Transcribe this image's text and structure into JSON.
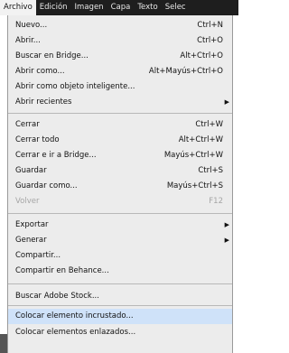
{
  "menubar": {
    "items": [
      "Archivo",
      "Edición",
      "Imagen",
      "Capa",
      "Texto",
      "Selec"
    ]
  },
  "menu": {
    "items": [
      {
        "label": "Nuevo...",
        "shortcut": "Ctrl+N"
      },
      {
        "label": "Abrir...",
        "shortcut": "Ctrl+O"
      },
      {
        "label": "Buscar en Bridge...",
        "shortcut": "Alt+Ctrl+O"
      },
      {
        "label": "Abrir como...",
        "shortcut": "Alt+Mayús+Ctrl+O"
      },
      {
        "label": "Abrir como objeto inteligente...",
        "shortcut": ""
      },
      {
        "label": "Abrir recientes",
        "shortcut": "",
        "submenu": true
      },
      {
        "label": "Cerrar",
        "shortcut": "Ctrl+W"
      },
      {
        "label": "Cerrar todo",
        "shortcut": "Alt+Ctrl+W"
      },
      {
        "label": "Cerrar e ir a Bridge...",
        "shortcut": "Mayús+Ctrl+W"
      },
      {
        "label": "Guardar",
        "shortcut": "Ctrl+S"
      },
      {
        "label": "Guardar como...",
        "shortcut": "Mayús+Ctrl+S"
      },
      {
        "label": "Volver",
        "shortcut": "F12",
        "disabled": true
      },
      {
        "label": "Exportar",
        "shortcut": "",
        "submenu": true
      },
      {
        "label": "Generar",
        "shortcut": "",
        "submenu": true
      },
      {
        "label": "Compartir...",
        "shortcut": ""
      },
      {
        "label": "Compartir en Behance...",
        "shortcut": ""
      },
      {
        "label": "Buscar Adobe Stock...",
        "shortcut": ""
      },
      {
        "label": "Colocar elemento incrustado...",
        "shortcut": "",
        "highlighted": true
      },
      {
        "label": "Colocar elementos enlazados...",
        "shortcut": ""
      }
    ]
  },
  "colors": {
    "menubar_bg": "#1e1e1e",
    "menu_bg": "#ececec",
    "highlight": "#cfe2f9",
    "disabled_text": "#a5a5a5"
  }
}
